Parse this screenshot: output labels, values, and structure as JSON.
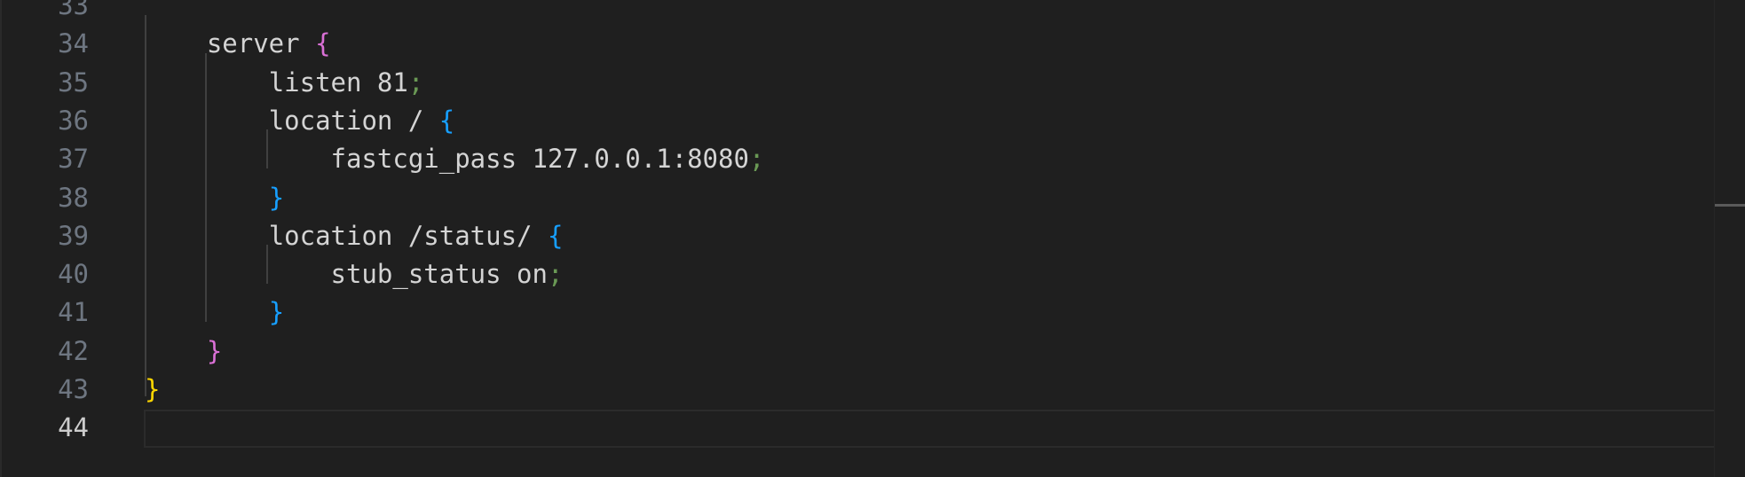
{
  "editor": {
    "lines": [
      {
        "number": "33",
        "text": ""
      },
      {
        "number": "34",
        "indent": "    ",
        "text": "server",
        "brace": " {",
        "brace_color": "p"
      },
      {
        "number": "35",
        "indent": "        ",
        "text": "listen 81",
        "semi": ";"
      },
      {
        "number": "36",
        "indent": "        ",
        "text": "location /",
        "brace": " {",
        "brace_color": "b"
      },
      {
        "number": "37",
        "indent": "            ",
        "text": "fastcgi_pass 127.0.0.1:8080",
        "semi": ";"
      },
      {
        "number": "38",
        "indent": "        ",
        "text": "",
        "brace": "}",
        "brace_color": "b"
      },
      {
        "number": "39",
        "indent": "        ",
        "text": "location /status/",
        "brace": " {",
        "brace_color": "b"
      },
      {
        "number": "40",
        "indent": "            ",
        "text": "stub_status on",
        "semi": ";"
      },
      {
        "number": "41",
        "indent": "        ",
        "text": "",
        "brace": "}",
        "brace_color": "b"
      },
      {
        "number": "42",
        "indent": "    ",
        "text": "",
        "brace": "}",
        "brace_color": "p"
      },
      {
        "number": "43",
        "indent": "",
        "text": "",
        "brace": "}",
        "brace_color": "y"
      },
      {
        "number": "44",
        "indent": "",
        "text": "",
        "active": true
      }
    ]
  },
  "colors": {
    "background": "#1f1f1f",
    "line_number": "#6e7681",
    "brace_yellow": "#ffd700",
    "brace_purple": "#da70d6",
    "brace_blue": "#179fff",
    "semicolon": "#6a9955"
  }
}
